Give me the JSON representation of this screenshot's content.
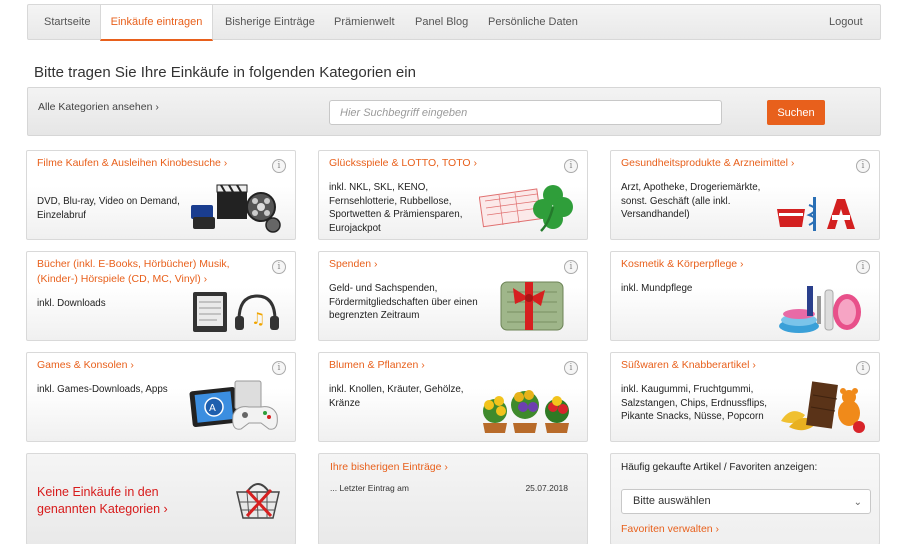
{
  "nav": {
    "items": [
      {
        "label": "Startseite"
      },
      {
        "label": "Einkäufe eintragen",
        "active": true
      },
      {
        "label": "Bisherige Einträge"
      },
      {
        "label": "Prämienwelt"
      },
      {
        "label": "Panel Blog"
      },
      {
        "label": "Persönliche Daten"
      }
    ],
    "logout": "Logout"
  },
  "page_title": "Bitte tragen Sie Ihre Einkäufe in folgenden Kategorien ein",
  "search": {
    "all_categories": "Alle Kategorien ansehen ›",
    "placeholder": "Hier Suchbegriff eingeben",
    "button": "Suchen"
  },
  "categories": [
    {
      "title": "Filme Kaufen & Ausleihen Kinobesuche ›",
      "desc": "DVD, Blu-ray, Video on Demand, Einzelabruf",
      "icon": "film-reel-icon"
    },
    {
      "title": "Glücksspiele & LOTTO, TOTO ›",
      "desc": "inkl. NKL, SKL, KENO, Fernsehlotterie, Rubbellose, Sportwetten & Prämiensparen, Eurojackpot",
      "icon": "lottery-clover-icon"
    },
    {
      "title": "Gesundheitsprodukte & Arzneimittel ›",
      "desc": "Arzt, Apotheke, Drogeriemärkte, sonst. Geschäft (alle inkl. Versandhandel)",
      "icon": "pharmacy-icon"
    },
    {
      "title": "Bücher (inkl. E-Books, Hörbücher) Musik, (Kinder-) Hörspiele (CD, MC, Vinyl) ›",
      "desc": "inkl. Downloads",
      "icon": "books-headphones-icon"
    },
    {
      "title": "Spenden ›",
      "desc": "Geld- und Sachspenden, Fördermitgliedschaften über einen begrenzten Zeitraum",
      "icon": "money-gift-icon"
    },
    {
      "title": "Kosmetik & Körperpflege ›",
      "desc": "inkl. Mundpflege",
      "icon": "cosmetics-icon"
    },
    {
      "title": "Games & Konsolen ›",
      "desc": "inkl. Games-Downloads, Apps",
      "icon": "gamepad-icon"
    },
    {
      "title": "Blumen & Pflanzen ›",
      "desc": "inkl. Knollen, Kräuter, Gehölze, Kränze",
      "icon": "flowers-icon"
    },
    {
      "title": "Süßwaren & Knabberartikel ›",
      "desc": "inkl. Kaugummi, Fruchtgummi, Salzstangen, Chips, Erdnussflips, Pikante Snacks, Nüsse, Popcorn",
      "icon": "sweets-icon"
    }
  ],
  "info_glyph": "i",
  "no_purchase": "Keine Einkäufe in den genannten Kategorien ›",
  "history": {
    "title": "Ihre bisherigen Einträge ›",
    "last_entry_label": "... Letzter Eintrag am",
    "last_entry_date": "25.07.2018"
  },
  "favorites": {
    "label": "Häufig gekaufte Artikel / Favoriten anzeigen:",
    "selected": "Bitte auswählen",
    "manage": "Favoriten verwalten ›"
  },
  "colors": {
    "accent": "#e8601c",
    "warning_red": "#d71b1b"
  }
}
